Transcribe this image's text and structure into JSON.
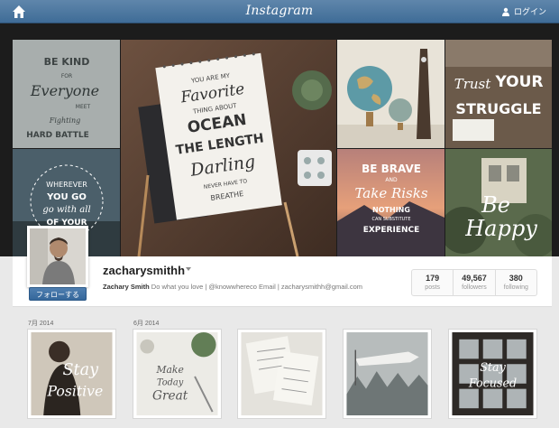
{
  "header": {
    "brand": "Instagram",
    "login_label": "ログイン",
    "icons": {
      "home": "home-icon",
      "user": "user-icon"
    }
  },
  "cover": {
    "tiles": [
      {
        "text": "BE KIND FOR Everyone YOU MEET Fighting HARD BATTLE",
        "icon": "be-kind-tile"
      },
      {
        "text": "YOU ARE MY Favorite THING ABOUT THE OCEAN THE LENGTH OF Darling NEVER HAVE TO BREATHE",
        "icon": "notebook-lettering-tile"
      },
      {
        "text": "",
        "icon": "globes-tile"
      },
      {
        "text": "Trust YOUR STRUGGLE",
        "icon": "trust-your-struggle-tile"
      },
      {
        "text": "WHEREVER YOU GO GO WITH ALL OF YOUR HEART",
        "icon": "wherever-you-go-tile"
      },
      {
        "text": "BE BRAVE AND Take Risks NOTHING CAN SUBSTITUTE EXPERIENCE",
        "icon": "be-brave-tile"
      },
      {
        "text": "Be Happy",
        "icon": "be-happy-tile"
      }
    ]
  },
  "profile": {
    "username": "zacharysmithh",
    "full_name": "Zachary Smith",
    "bio": "Do what you love | @knowwhereco Email | zacharysmithh@gmail.com",
    "follow_label": "フォローする",
    "stats": [
      {
        "value": "179",
        "label": "posts"
      },
      {
        "value": "49,567",
        "label": "followers"
      },
      {
        "value": "380",
        "label": "following"
      }
    ]
  },
  "feed": {
    "months": [
      "7月 2014",
      "6月 2014"
    ],
    "posts": [
      {
        "text": "Stay Positive",
        "icon": "stay-positive-post"
      },
      {
        "text": "Make Today Great",
        "icon": "make-today-great-post"
      },
      {
        "text": "",
        "icon": "sketches-post"
      },
      {
        "text": "",
        "icon": "banner-forest-post"
      },
      {
        "text": "Stay Focused",
        "icon": "stay-focused-post"
      }
    ]
  }
}
